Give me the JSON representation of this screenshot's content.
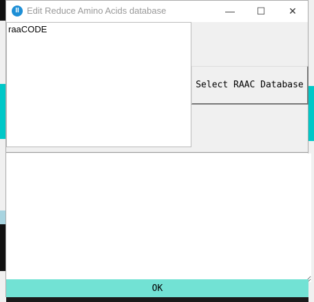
{
  "window": {
    "title": "Edit Reduce Amino Acids database",
    "icon": "app-logo-icon"
  },
  "controls": {
    "minimize": "—",
    "maximize": "☐",
    "close": "✕"
  },
  "list": {
    "items": [
      "raaCODE"
    ]
  },
  "buttons": {
    "select_db": "Select RAAC Database",
    "ok": "OK"
  },
  "text_area": {
    "value": ""
  },
  "colors": {
    "ok_bar": "#72e2d4"
  }
}
